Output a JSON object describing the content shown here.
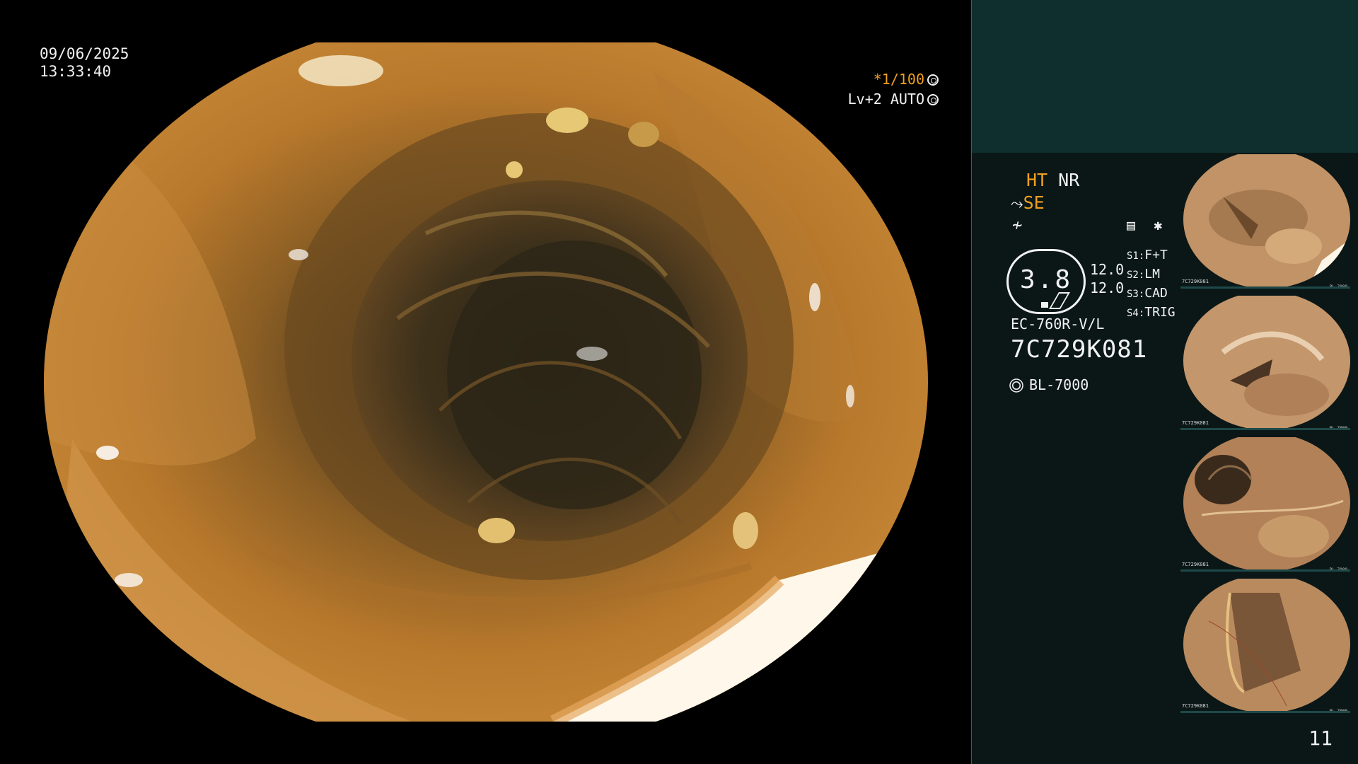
{
  "main": {
    "date": "09/06/2025",
    "time": "13:33:40",
    "shutter_speed": "*1/100",
    "enhancement": "Lv+2 AUTO"
  },
  "panel": {
    "ht": "HT",
    "nr": "NR",
    "se": "SE",
    "zoom_value": "3.8",
    "num_top": "12.0",
    "num_bottom": "12.0",
    "slots": [
      {
        "key": "S1",
        "value": "F+T"
      },
      {
        "key": "S2",
        "value": "LM"
      },
      {
        "key": "S3",
        "value": "CAD"
      },
      {
        "key": "S4",
        "value": "TRIG"
      }
    ],
    "scope_model": "EC-760R-V/L",
    "scope_serial": "7C729K081",
    "light_source": "BL-7000",
    "thumbnails": [
      {
        "serial": "7C729K081",
        "light": "BL-7000"
      },
      {
        "serial": "7C729K081",
        "light": "BL-7000"
      },
      {
        "serial": "7C729K081",
        "light": "BL-7000"
      },
      {
        "serial": "7C729K081",
        "light": "BL-7000"
      }
    ],
    "page_number": "11"
  },
  "colors": {
    "accent_orange": "#f0a020",
    "panel_bg": "#0b1717",
    "panel_top": "#0f2e2e"
  },
  "icons": [
    "shutter-wheel-icon",
    "auto-ring-icon",
    "scope-tip-icon",
    "freeze-icon",
    "document-icon",
    "asterisk-icon",
    "light-source-icon"
  ]
}
